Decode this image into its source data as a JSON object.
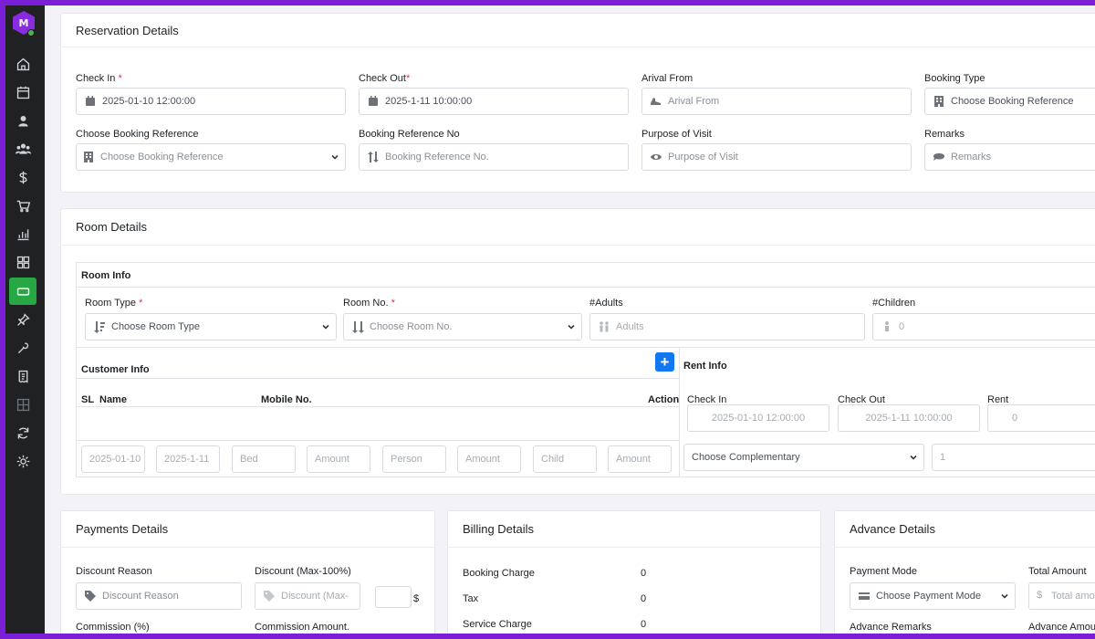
{
  "colors": {
    "sidebar": "#1f2123",
    "accent": "#28a745",
    "frame": "#7a1fd6",
    "primary_button": "#1178f2"
  },
  "sidebar": {
    "items": [
      {
        "icon": "home-icon"
      },
      {
        "icon": "calendar-icon"
      },
      {
        "icon": "user-icon"
      },
      {
        "icon": "users-icon"
      },
      {
        "icon": "dollar-icon"
      },
      {
        "icon": "cart-icon"
      },
      {
        "icon": "chart-icon"
      },
      {
        "icon": "grid-icon"
      },
      {
        "icon": "ticket-icon",
        "active": true
      },
      {
        "icon": "pin-icon"
      },
      {
        "icon": "wrench-icon"
      },
      {
        "icon": "receipt-icon"
      },
      {
        "icon": "layout-icon"
      },
      {
        "icon": "refresh-icon"
      },
      {
        "icon": "gear-icon"
      }
    ]
  },
  "reservation": {
    "title": "Reservation Details",
    "check_in_label": "Check In ",
    "check_in_value": "2025-01-10 12:00:00",
    "check_out_label": "Check Out",
    "check_out_value": "2025-1-11 10:00:00",
    "arrival_label": "Arival From",
    "arrival_placeholder": "Arival From",
    "booking_type_label": "Booking Type",
    "booking_type_value": "Choose Booking Reference",
    "booking_ref_label": "Choose Booking Reference",
    "booking_ref_value": "Choose Booking Reference",
    "booking_ref_no_label": "Booking Reference No",
    "booking_ref_no_placeholder": "Booking Reference No.",
    "purpose_label": "Purpose of Visit",
    "purpose_placeholder": "Purpose of Visit",
    "remarks_label": "Remarks",
    "remarks_placeholder": "Remarks",
    "required_mark": "*"
  },
  "room": {
    "title": "Room Details",
    "room_info_title": "Room Info",
    "room_type_label": "Room Type ",
    "room_type_value": "Choose Room Type",
    "room_no_label": "Room No. ",
    "room_no_value": "Choose Room No.",
    "adults_label": "#Adults",
    "adults_placeholder": "Adults",
    "children_label": "#Children",
    "children_value": "0",
    "customer_info_title": "Customer Info",
    "add_symbol": "+",
    "rent_info_title": "Rent Info",
    "table_headers": {
      "sl": "SL",
      "name": "Name",
      "mobile": "Mobile No.",
      "action": "Action"
    },
    "rent_headers": {
      "check_in": "Check In",
      "check_out": "Check Out",
      "rent": "Rent"
    },
    "rent_check_in": "2025-01-10 12:00:00",
    "rent_check_out": "2025-1-11 10:00:00",
    "rent_value": "0",
    "footer_fields": [
      "2025-01-10",
      "2025-1-11",
      "Bed",
      "Amount",
      "Person",
      "Amount",
      "Child",
      "Amount"
    ],
    "complementary_value": "Choose Complementary",
    "complementary_qty": "1"
  },
  "payments": {
    "title": "Payments Details",
    "discount_reason_label": "Discount Reason",
    "discount_reason_placeholder": "Discount Reason",
    "discount_label": "Discount (Max-100%)",
    "discount_placeholder": "Discount (Max-",
    "currency": "$",
    "commission_label": "Commission (%)",
    "commission_amount_label": "Commission Amount."
  },
  "billing": {
    "title": "Billing Details",
    "rows": [
      {
        "label": "Booking Charge",
        "value": "0"
      },
      {
        "label": "Tax",
        "value": "0"
      },
      {
        "label": "Service Charge",
        "value": "0"
      }
    ]
  },
  "advance": {
    "title": "Advance Details",
    "payment_mode_label": "Payment Mode",
    "payment_mode_value": "Choose Payment Mode",
    "total_amount_label": "Total Amount",
    "total_amount_placeholder": "Total amo",
    "currency": "$",
    "advance_remarks_label": "Advance Remarks",
    "advance_amount_label": "Advance Amou"
  }
}
